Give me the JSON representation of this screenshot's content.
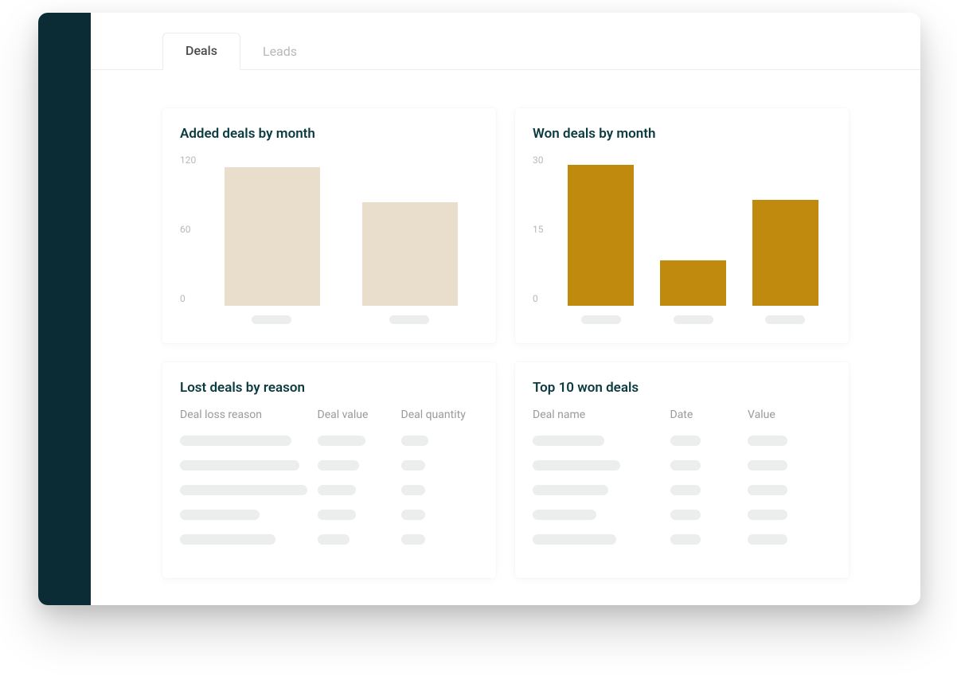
{
  "tabs": [
    {
      "label": "Deals",
      "active": true
    },
    {
      "label": "Leads",
      "active": false
    }
  ],
  "cards": {
    "added_deals": {
      "title": "Added deals  by month",
      "y_ticks": [
        "120",
        "60",
        "0"
      ]
    },
    "won_deals": {
      "title": "Won deals  by month",
      "y_ticks": [
        "30",
        "15",
        "0"
      ]
    },
    "lost_deals": {
      "title": "Lost deals by reason",
      "columns": [
        "Deal loss reason",
        "Deal value",
        "Deal quantity"
      ]
    },
    "top_won": {
      "title": "Top 10 won deals",
      "columns": [
        "Deal name",
        "Date",
        "Value"
      ]
    }
  },
  "colors": {
    "sidebar": "#0b2c34",
    "accent_gold": "#c08a0f",
    "accent_cream": "#e9decb",
    "heading": "#0b3b3f"
  },
  "chart_data": [
    {
      "id": "added_deals",
      "type": "bar",
      "title": "Added deals  by month",
      "ylabel": "",
      "ylim": [
        0,
        120
      ],
      "categories": [
        "",
        ""
      ],
      "values": [
        110,
        82
      ],
      "color": "#e9decb"
    },
    {
      "id": "won_deals",
      "type": "bar",
      "title": "Won deals  by month",
      "ylabel": "",
      "ylim": [
        0,
        30
      ],
      "categories": [
        "",
        "",
        ""
      ],
      "values": [
        28,
        9,
        21
      ],
      "color": "#c08a0f"
    }
  ]
}
